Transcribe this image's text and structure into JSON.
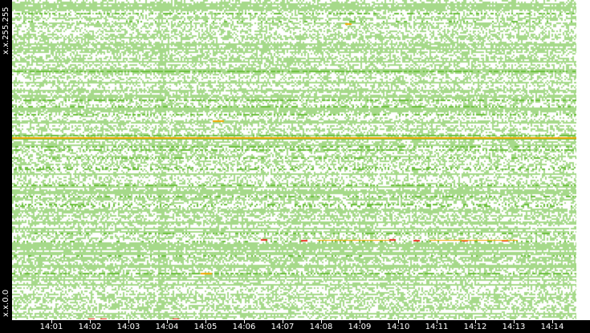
{
  "chart_data": {
    "type": "heatmap",
    "title": "",
    "ylabel_top": "x.x.255.255",
    "ylabel_bottom": "x.x.0.0",
    "x_ticks": [
      "14:01",
      "14:02",
      "14:03",
      "14:04",
      "14:05",
      "14:06",
      "14:07",
      "14:08",
      "14:09",
      "14:10",
      "14:11",
      "14:12",
      "14:13",
      "14:14"
    ],
    "y_range": [
      "x.x.0.0",
      "x.x.255.255"
    ],
    "colors": {
      "low": "#a6d98a",
      "mid": "#6cbf3c",
      "high": "#f2a900",
      "max": "#e8321e",
      "background": "#ffffff"
    },
    "highlights": [
      {
        "row_label": "orange band",
        "level": "high",
        "span": "14:00-14:14"
      },
      {
        "row_label": "red segments",
        "level": "max",
        "span": "14:07-14:13"
      }
    ]
  }
}
